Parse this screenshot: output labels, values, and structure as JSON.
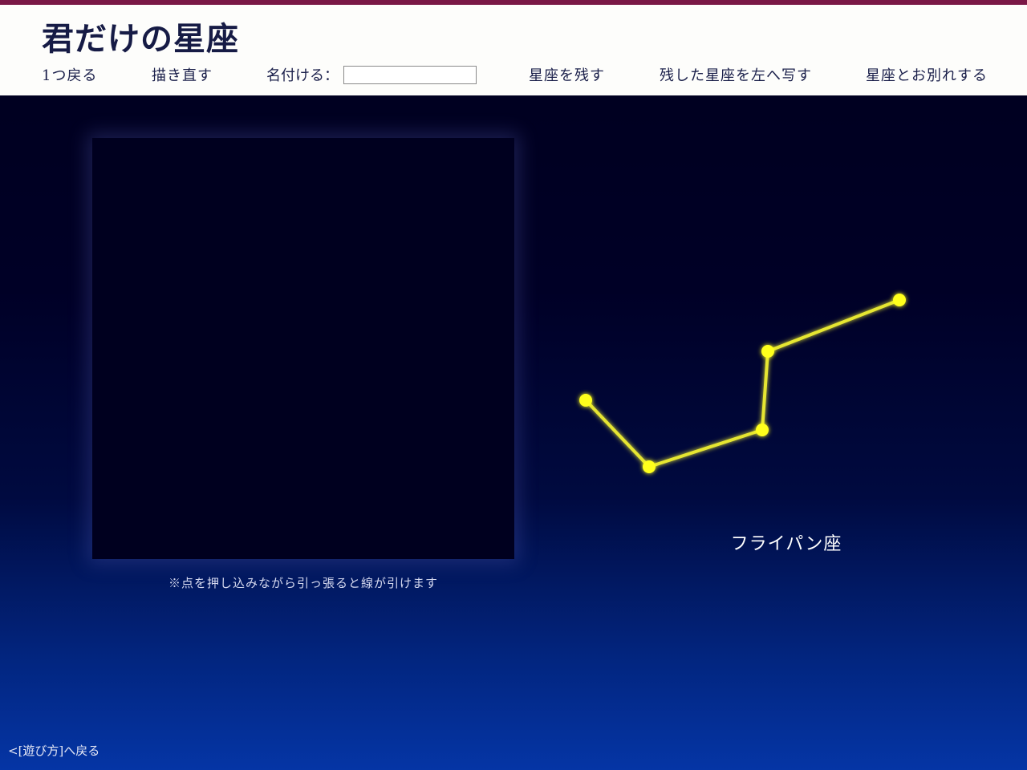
{
  "header": {
    "title": "君だけの星座",
    "menu": {
      "undo": "1つ戻る",
      "redraw": "描き直す",
      "name_label": "名付ける：",
      "name_value": "",
      "save": "星座を残す",
      "copy_left": "残した星座を左へ写す",
      "farewell": "星座とお別れする"
    }
  },
  "canvas": {
    "hint": "※点を押し込みながら引っ張ると線が引けます"
  },
  "constellation": {
    "name": "フライパン座",
    "star_color": "#ffff1e",
    "line_color": "#e6e632",
    "stars": [
      {
        "label": "star-1"
      },
      {
        "label": "star-2"
      },
      {
        "label": "star-3"
      },
      {
        "label": "star-4"
      },
      {
        "label": "star-5"
      }
    ]
  },
  "footer": {
    "back_link": "<[遊び方]へ戻る"
  }
}
